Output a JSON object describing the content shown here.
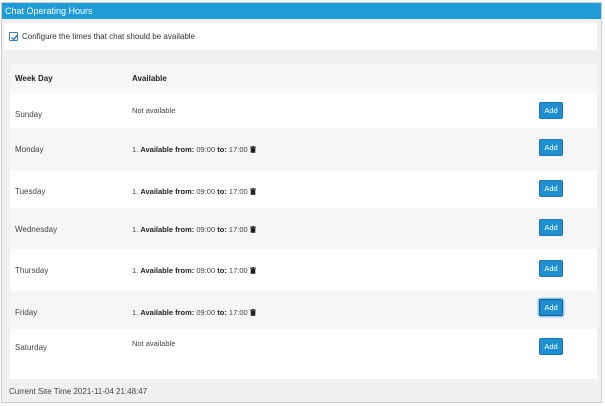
{
  "panel": {
    "title": "Chat Operating Hours",
    "config_label": "Configure the times that chat should be available",
    "config_checked": true
  },
  "table": {
    "headers": {
      "day": "Week Day",
      "available": "Available"
    },
    "rows": [
      {
        "day": "Sunday",
        "available": false,
        "not_available_text": "Not available",
        "add_label": "Add"
      },
      {
        "day": "Monday",
        "available": true,
        "slot_index": "1.",
        "from_label": "Available from:",
        "from": "09:00",
        "to_label": "to:",
        "to": "17:00",
        "add_label": "Add"
      },
      {
        "day": "Tuesday",
        "available": true,
        "slot_index": "1.",
        "from_label": "Available from:",
        "from": "09:00",
        "to_label": "to:",
        "to": "17:00",
        "add_label": "Add"
      },
      {
        "day": "Wednesday",
        "available": true,
        "slot_index": "1.",
        "from_label": "Available from:",
        "from": "09:00",
        "to_label": "to:",
        "to": "17:00",
        "add_label": "Add"
      },
      {
        "day": "Thursday",
        "available": true,
        "slot_index": "1.",
        "from_label": "Available from:",
        "from": "09:00",
        "to_label": "to:",
        "to": "17:00",
        "add_label": "Add"
      },
      {
        "day": "Friday",
        "available": true,
        "slot_index": "1.",
        "from_label": "Available from:",
        "from": "09:00",
        "to_label": "to:",
        "to": "17:00",
        "add_label": "Add",
        "focused": true
      },
      {
        "day": "Saturday",
        "available": false,
        "not_available_text": "Not available",
        "add_label": "Add"
      }
    ]
  },
  "footer": {
    "site_time_label": "Current Site Time",
    "site_time": "2021-11-04 21:48:47"
  },
  "colors": {
    "header_bg": "#1f9bd8",
    "button_bg": "#1f8fd1",
    "panel_bg": "#f0f0f0"
  },
  "icons": {
    "delete": "trash-icon",
    "checkbox": "checkmark-icon"
  }
}
